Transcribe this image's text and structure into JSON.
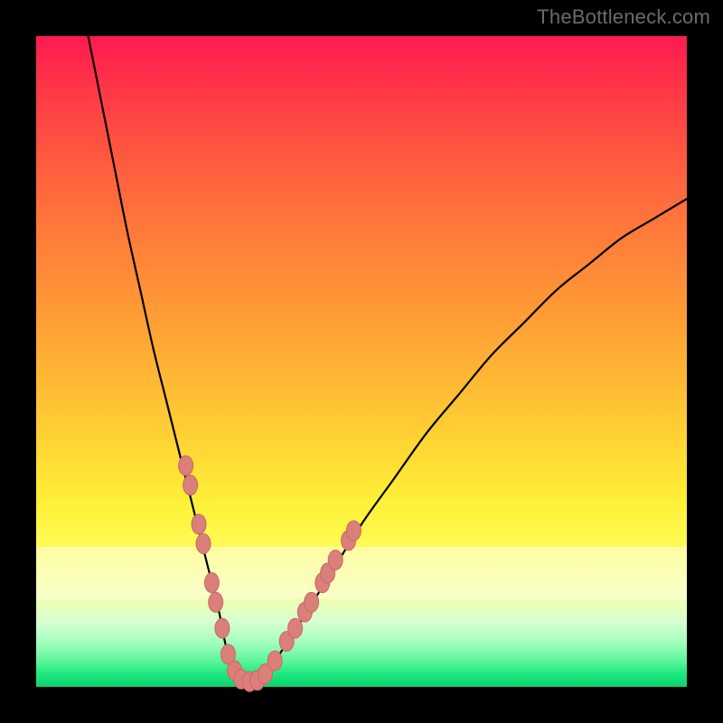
{
  "watermark": "TheBottleneck.com",
  "colors": {
    "frame_bg": "#000000",
    "curve": "#000000",
    "dot_fill": "#db7f7a",
    "dot_stroke": "#c76a64",
    "gradient_top": "#ff1a52",
    "gradient_bottom": "#0cd26f",
    "pale_band": "#fffde0"
  },
  "chart_data": {
    "type": "line",
    "title": "",
    "xlabel": "",
    "ylabel": "",
    "xlim": [
      0,
      100
    ],
    "ylim": [
      0,
      100
    ],
    "grid": false,
    "legend": false,
    "series": [
      {
        "name": "bottleneck-curve",
        "x": [
          8,
          10,
          12,
          14,
          16,
          18,
          20,
          22,
          24,
          26,
          28,
          29,
          30,
          31,
          32,
          34,
          36,
          40,
          45,
          50,
          55,
          60,
          65,
          70,
          75,
          80,
          85,
          90,
          95,
          100
        ],
        "y": [
          100,
          90,
          80,
          70,
          61,
          52,
          44,
          36,
          28,
          20,
          12,
          7,
          3,
          1,
          0,
          1,
          3,
          9,
          17,
          25,
          32,
          39,
          45,
          51,
          56,
          61,
          65,
          69,
          72,
          75
        ]
      }
    ],
    "markers": [
      {
        "x": 23.0,
        "y": 34
      },
      {
        "x": 23.7,
        "y": 31
      },
      {
        "x": 25.0,
        "y": 25
      },
      {
        "x": 25.7,
        "y": 22
      },
      {
        "x": 27.0,
        "y": 16
      },
      {
        "x": 27.6,
        "y": 13
      },
      {
        "x": 28.6,
        "y": 9
      },
      {
        "x": 29.5,
        "y": 5
      },
      {
        "x": 30.5,
        "y": 2.5
      },
      {
        "x": 31.5,
        "y": 1.2
      },
      {
        "x": 32.8,
        "y": 0.8
      },
      {
        "x": 34.0,
        "y": 1.0
      },
      {
        "x": 35.2,
        "y": 2.0
      },
      {
        "x": 36.7,
        "y": 4.0
      },
      {
        "x": 38.5,
        "y": 7.0
      },
      {
        "x": 39.8,
        "y": 9.0
      },
      {
        "x": 41.3,
        "y": 11.5
      },
      {
        "x": 42.3,
        "y": 13.0
      },
      {
        "x": 44.0,
        "y": 16.0
      },
      {
        "x": 44.8,
        "y": 17.5
      },
      {
        "x": 46.0,
        "y": 19.5
      },
      {
        "x": 48.0,
        "y": 22.5
      },
      {
        "x": 48.8,
        "y": 24.0
      }
    ]
  }
}
